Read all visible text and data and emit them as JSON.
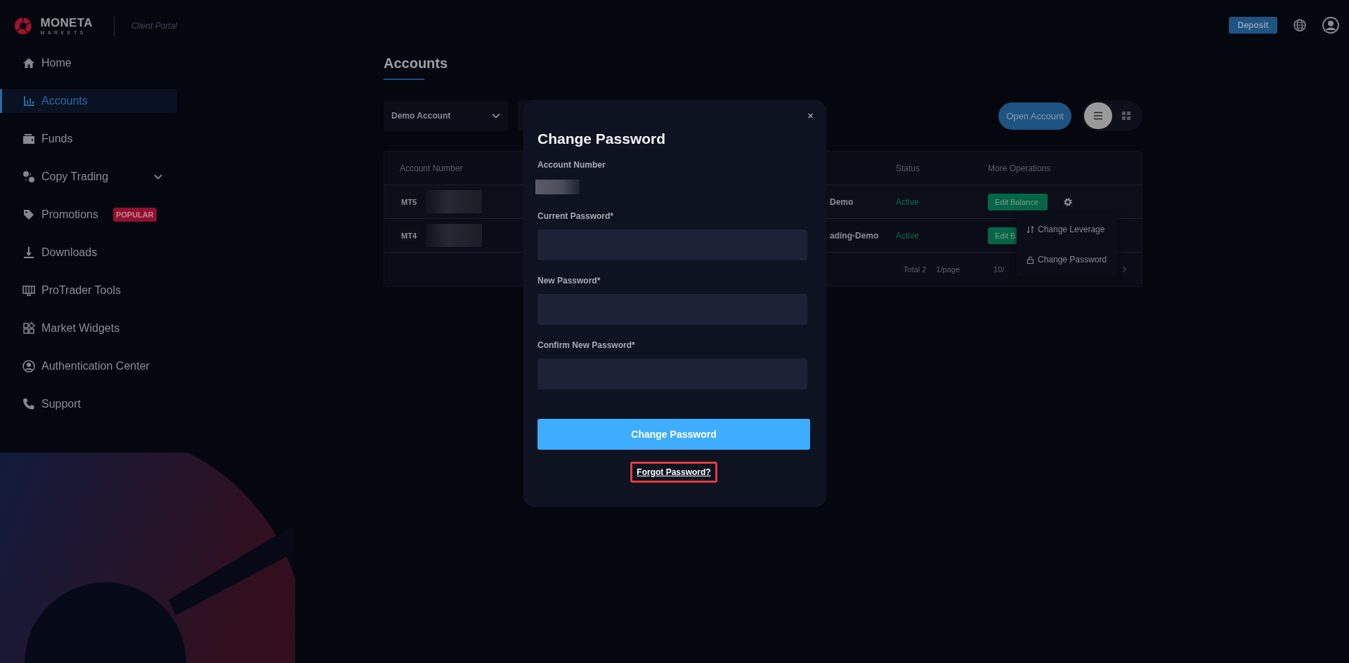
{
  "brand": {
    "name": "MONETA",
    "sub": "MARKETS",
    "portal": "Client Portal"
  },
  "sidebar": {
    "items": [
      {
        "label": "Home",
        "kind": "home",
        "selected": false,
        "expandable": false
      },
      {
        "label": "Accounts",
        "kind": "chart",
        "selected": true,
        "expandable": false
      },
      {
        "label": "Funds",
        "kind": "wallet",
        "selected": false,
        "expandable": false
      },
      {
        "label": "Copy Trading",
        "kind": "copy",
        "selected": false,
        "expandable": true
      },
      {
        "label": "Promotions",
        "kind": "tag",
        "selected": false,
        "expandable": false,
        "badge": "POPULAR"
      },
      {
        "label": "Downloads",
        "kind": "download",
        "selected": false,
        "expandable": false
      },
      {
        "label": "ProTrader Tools",
        "kind": "tools",
        "selected": false,
        "expandable": false
      },
      {
        "label": "Market Widgets",
        "kind": "widgets",
        "selected": false,
        "expandable": false
      },
      {
        "label": "Authentication Center",
        "kind": "user",
        "selected": false,
        "expandable": false
      },
      {
        "label": "Support",
        "kind": "phone",
        "selected": false,
        "expandable": false
      }
    ]
  },
  "header": {
    "deposit": "Deposit"
  },
  "page": {
    "title": "Accounts",
    "filter": "Demo Account",
    "open_account": "Open Account",
    "views": [
      {
        "kind": "list",
        "selected": true
      },
      {
        "kind": "grid",
        "selected": false
      }
    ]
  },
  "table": {
    "columns": [
      "Account Number",
      "Status",
      "More Operations"
    ],
    "rows": [
      {
        "platform": "MT5",
        "account_type": "Demo",
        "status": "Active",
        "action": "Edit Balance"
      },
      {
        "platform": "MT4",
        "account_type": "ading-Demo",
        "status": "Active",
        "action": "Edit B"
      }
    ],
    "footer": {
      "total": "Total 2",
      "page_size": "1/page",
      "jump": "10/"
    }
  },
  "menu": {
    "items": [
      {
        "label": "Change Leverage",
        "kind": "leverage"
      },
      {
        "label": "Change Password",
        "kind": "lock"
      }
    ]
  },
  "modal": {
    "title": "Change Password",
    "close": "×",
    "account_label": "Account Number",
    "fields": [
      {
        "label": "Current Password*"
      },
      {
        "label": "New Password*"
      },
      {
        "label": "Confirm New Password*"
      }
    ],
    "submit": "Change Password",
    "forgot": "Forgot Password?"
  }
}
